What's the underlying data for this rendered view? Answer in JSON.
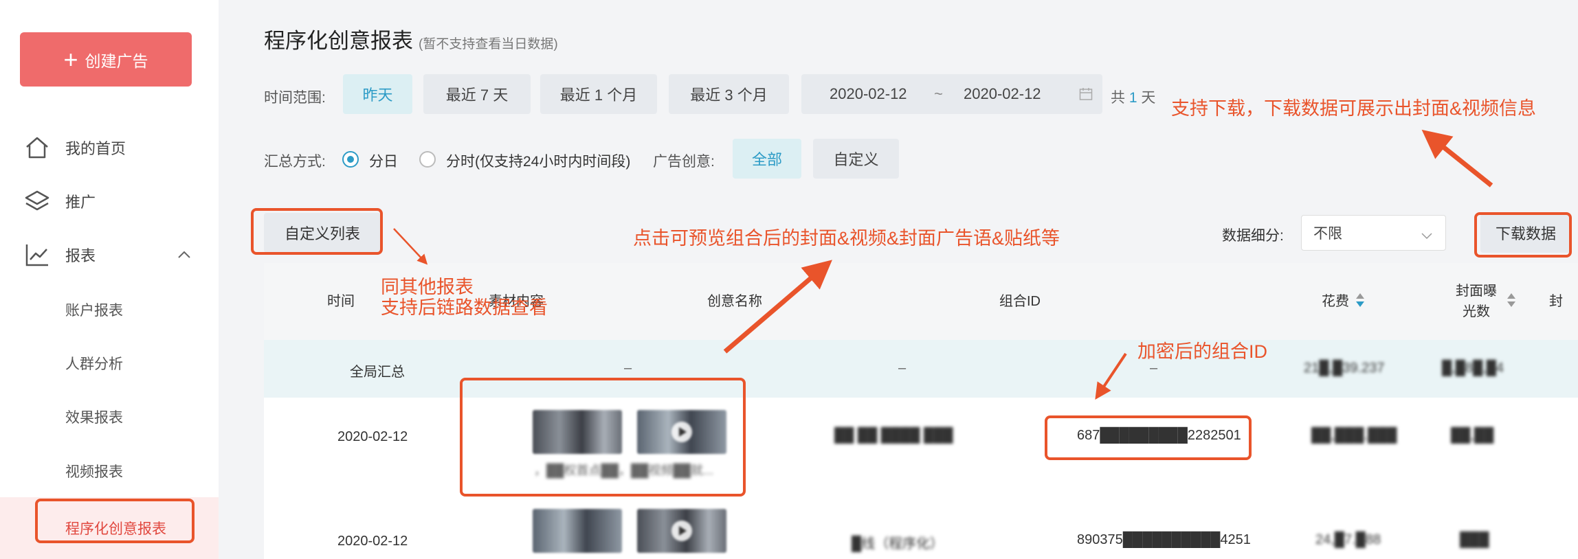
{
  "sidebar": {
    "create_label": "创建广告",
    "nav": [
      {
        "label": "我的首页",
        "icon": "home-icon"
      },
      {
        "label": "推广",
        "icon": "layers-icon"
      },
      {
        "label": "报表",
        "icon": "chart-line-icon"
      }
    ],
    "sub": [
      {
        "label": "账户报表"
      },
      {
        "label": "人群分析"
      },
      {
        "label": "效果报表"
      },
      {
        "label": "视频报表"
      },
      {
        "label": "程序化创意报表"
      }
    ]
  },
  "page": {
    "title": "程序化创意报表",
    "subtitle": "(暂不支持查看当日数据)"
  },
  "filters": {
    "time_label": "时间范围:",
    "time_options": [
      "昨天",
      "最近 7 天",
      "最近 1 个月",
      "最近 3 个月"
    ],
    "time_selected": "昨天",
    "date_start": "2020-02-12",
    "date_sep": "~",
    "date_end": "2020-02-12",
    "days_prefix": "共",
    "days_value": "1",
    "days_suffix": "天",
    "agg_label": "汇总方式:",
    "agg_day": "分日",
    "agg_hour": "分时(仅支持24小时内时间段)",
    "creative_label": "广告创意:",
    "creative_all": "全部",
    "creative_custom": "自定义"
  },
  "toolbar": {
    "custom_columns": "自定义列表",
    "detail_label": "数据细分:",
    "detail_value": "不限",
    "download": "下载数据"
  },
  "table": {
    "headers": [
      "时间",
      "素材内容",
      "创意名称",
      "组合ID",
      "花费",
      "封面曝光数",
      "封"
    ],
    "summary": {
      "time": "全局汇总",
      "material": "–",
      "name": "–",
      "id": "–",
      "cost": "21█,█39.237",
      "exposure": "█,█8█,█4"
    },
    "rows": [
      {
        "time": "2020-02-12",
        "caption": "，██权首点██，██视频██就...",
        "name": "██ ██ ████ ███",
        "id": "687█████████2282501",
        "cost": "██,███.███",
        "exposure": "██,██"
      },
      {
        "time": "2020-02-12",
        "caption": "",
        "name": "█线（程序化）",
        "id": "890375██████████4251",
        "cost": "24,█7.█88",
        "exposure": "███"
      }
    ]
  },
  "annotations": {
    "download_note": "支持下载，下载数据可展示出封面&视频信息",
    "preview_note": "点击可预览组合后的封面&视频&封面广告语&贴纸等",
    "custom_note_1": "同其他报表",
    "custom_note_2": "支持后链路数据查看",
    "id_note": "加密后的组合ID",
    "color": "#e9542b"
  },
  "colors": {
    "brand": "#ef6b6b",
    "accent": "#2c9bc6",
    "active_sub_bg": "#fdecec"
  }
}
